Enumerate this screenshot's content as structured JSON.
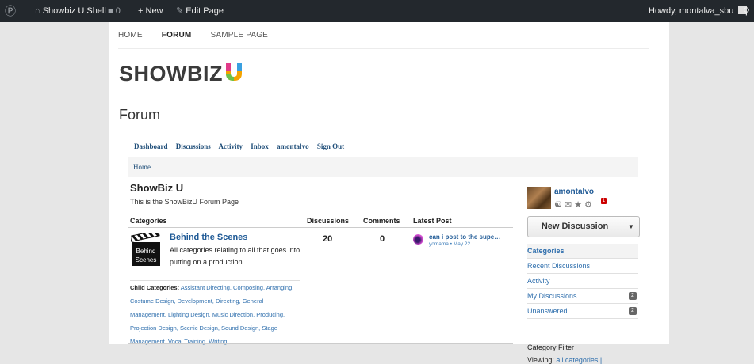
{
  "adminbar": {
    "site_name": "Showbiz U Shell",
    "comments_count": "0",
    "new_label": "New",
    "edit_label": "Edit Page",
    "howdy": "Howdy, montalva_sbu"
  },
  "nav": {
    "home": "HOME",
    "forum": "FORUM",
    "sample": "SAMPLE PAGE"
  },
  "logo_text": "SHOWBIZ",
  "page_title": "Forum",
  "forum_menu": [
    "Dashboard",
    "Discussions",
    "Activity",
    "Inbox",
    "amontalvo",
    "Sign Out"
  ],
  "breadcrumb": "Home",
  "forum": {
    "title": "ShowBiz U",
    "description": "This is the ShowBizU Forum Page"
  },
  "table": {
    "headers": {
      "categories": "Categories",
      "discussions": "Discussions",
      "comments": "Comments",
      "latest": "Latest Post"
    },
    "row": {
      "icon_label_1": "Behind",
      "icon_label_2": "Scenes",
      "name": "Behind the Scenes",
      "description": "All categories relating to all that goes into putting on a production.",
      "child_label": "Child Categories:",
      "child_list": "Assistant Directing, Composing, Arranging, Costume Design, Development, Directing, General Management, Lighting Design, Music Direction, Producing, Projection Design, Scenic Design, Sound Design, Stage Management, Vocal Training, Writing",
      "discussions": "20",
      "comments": "0",
      "latest_title": "can i post to the supe…",
      "latest_meta": "yomama • May 22"
    }
  },
  "sidebar": {
    "username": "amontalvo",
    "notification_count": "1",
    "new_discussion": "New Discussion",
    "menu": [
      {
        "label": "Categories",
        "count": ""
      },
      {
        "label": "Recent Discussions",
        "count": ""
      },
      {
        "label": "Activity",
        "count": ""
      },
      {
        "label": "My Discussions",
        "count": "2"
      },
      {
        "label": "Unanswered",
        "count": "2"
      }
    ],
    "filter_label": "Category Filter",
    "viewing_label": "Viewing:",
    "viewing_value": "all categories |"
  },
  "colors": {
    "adminbar": "#23282d",
    "link": "#1f5a96",
    "logo_u": "#f4a300"
  }
}
